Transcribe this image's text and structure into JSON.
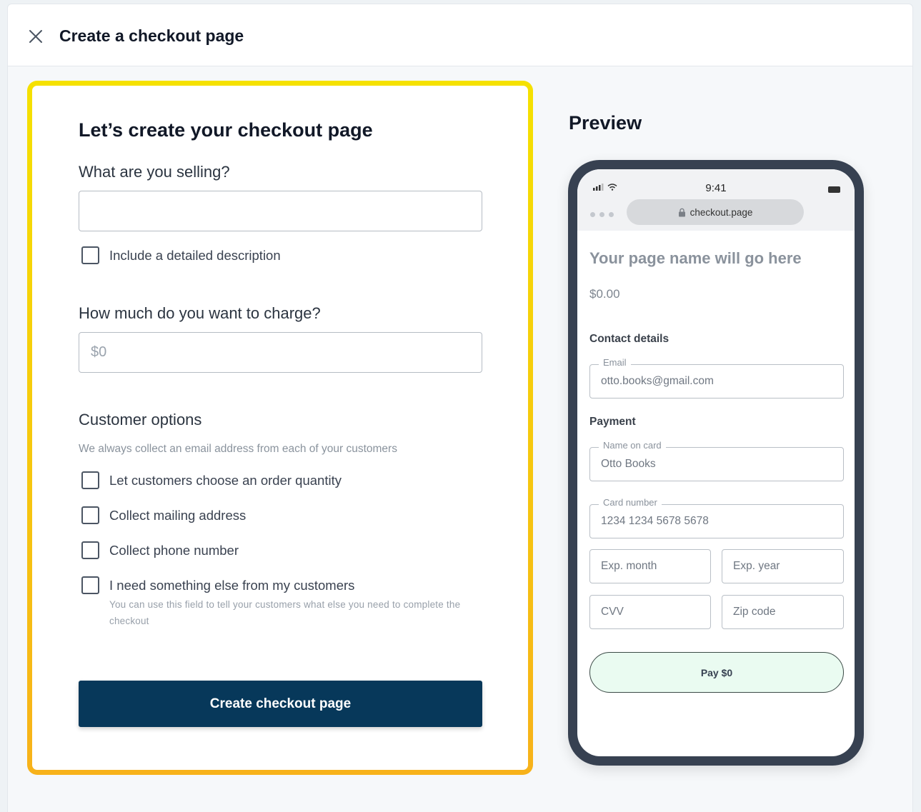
{
  "header": {
    "title": "Create a checkout page",
    "close_icon": "close-icon"
  },
  "form": {
    "title": "Let’s create your checkout page",
    "selling_label": "What are you selling?",
    "selling_value": "",
    "include_description_label": "Include a detailed description",
    "include_description_checked": false,
    "charge_label": "How much do you want to charge?",
    "charge_placeholder": "$0",
    "customer_options_title": "Customer options",
    "customer_options_helper": "We always collect an email address from each of your customers",
    "options": [
      {
        "label": "Let customers choose an order quantity",
        "checked": false
      },
      {
        "label": "Collect mailing address",
        "checked": false
      },
      {
        "label": "Collect phone number",
        "checked": false
      },
      {
        "label": "I need something else from my customers",
        "checked": false
      }
    ],
    "other_helper": "You can use this field to tell your customers what else you need to complete the checkout",
    "submit_label": "Create checkout page",
    "submit_color": "#07385a",
    "highlight_colors": [
      "#f5e100",
      "#f7b21a"
    ]
  },
  "preview": {
    "title": "Preview",
    "status_time": "9:41",
    "url": "checkout.page",
    "page_name": "Your page name will go here",
    "price": "$0.00",
    "contact_title": "Contact details",
    "email_legend": "Email",
    "email_value": "otto.books@gmail.com",
    "payment_title": "Payment",
    "name_legend": "Name on card",
    "name_value": "Otto Books",
    "card_legend": "Card number",
    "card_value": "1234 1234 5678 5678",
    "exp_month": "Exp. month",
    "exp_year": "Exp. year",
    "cvv": "CVV",
    "zip": "Zip code",
    "pay_label": "Pay $0",
    "pay_bg": "#eafbf1"
  }
}
